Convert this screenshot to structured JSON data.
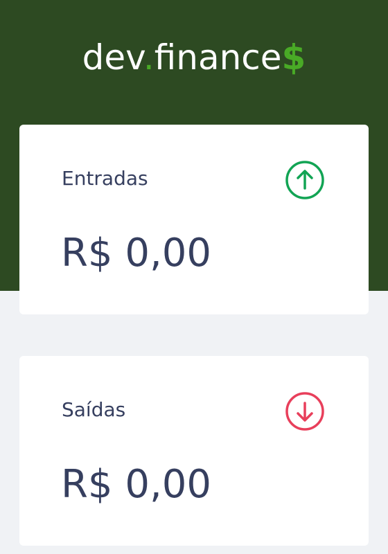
{
  "header": {
    "logo_prefix": "dev",
    "logo_dot": ".",
    "logo_name": "finance",
    "logo_suffix": "$",
    "background_color": "#2d4a22",
    "accent_color": "#49aa26"
  },
  "cards": {
    "income": {
      "title": "Entradas",
      "value": "R$ 0,00",
      "icon": "arrow-up-circle-icon",
      "icon_color": "#12a454"
    },
    "expense": {
      "title": "Saídas",
      "value": "R$ 0,00",
      "icon": "arrow-down-circle-icon",
      "icon_color": "#e92929"
    }
  }
}
